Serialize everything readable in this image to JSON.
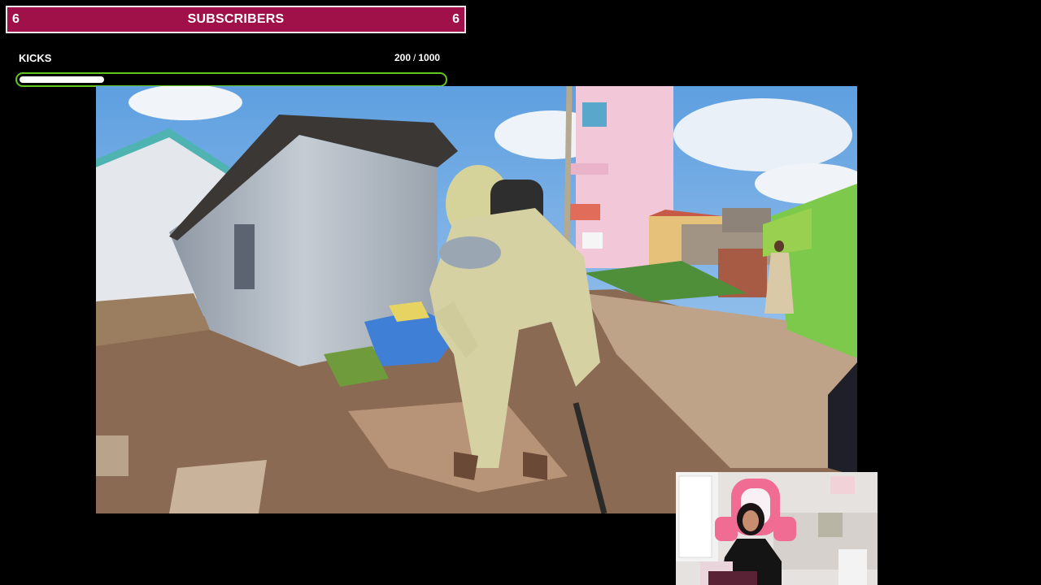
{
  "subscribers_goal": {
    "left_count": "6",
    "title": "SUBSCRIBERS",
    "right_count": "6"
  },
  "kicks_goal": {
    "label": "KICKS",
    "current": "200",
    "separator": "/",
    "target": "1000",
    "progress_fraction": 0.2
  },
  "stream": {
    "main_feed": "village-scene-video",
    "webcam_feed": "streamer-webcam"
  },
  "colors": {
    "banner_bg": "#a0114a",
    "bar_border": "#64c51e",
    "bar_fill": "#ffffff",
    "page_bg": "#000000"
  }
}
